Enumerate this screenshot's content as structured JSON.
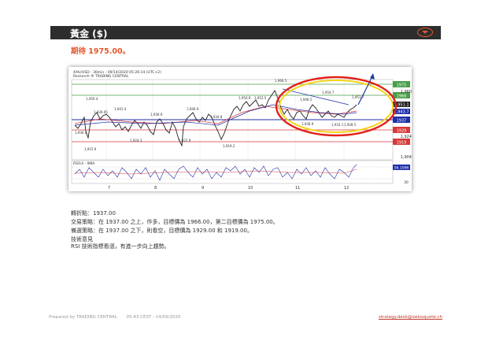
{
  "header": {
    "title": "黃金 ($)"
  },
  "subtitle": "期待 1975.00。",
  "chart": {
    "title": "XAU/USD - 30min - 09/14/2020 05:26:14 (UTC+2)",
    "source": "Research ® TRADING CENTRAL",
    "rsi_label": "RSI14 - 9MA",
    "rsi_value": "56.1096",
    "price_ticks": [
      "1,960",
      "1,951.1",
      "1,943.7",
      "1,924",
      "1,904"
    ],
    "level_labels": [
      "1975",
      "1966",
      "1937",
      "1929",
      "1919"
    ],
    "rsi_ticks": [
      "70",
      "30"
    ],
    "day_labels": [
      "7",
      "8",
      "9",
      "10",
      "11",
      "12"
    ],
    "point_labels": [
      "1,950.4",
      "1,939.05",
      "1,941.4",
      "1,936.9",
      "1,946.9",
      "1,934.8",
      "1,950.9",
      "1,953.5",
      "1,966.5",
      "1,946.5",
      "1,954.7",
      "1,951.7",
      "1,930.4",
      "1,915.9",
      "1,924.3",
      "1,922.9",
      "1,919.2",
      "1,936.9",
      "1,933.1",
      "1,928.5"
    ],
    "colors": {
      "level_green": "#4a9e4a",
      "level_blue": "#1f2fa8",
      "level_red": "#d63a3a",
      "ellipse_outer": "#e32119",
      "ellipse_inner": "#f5d41a",
      "arrow": "#1a3c9e"
    }
  },
  "info": {
    "pivot": "轉折點：1937.00",
    "strategy": "交易策略：在 1937.00 之上，作多，目標價為 1966.00，第二目標價為 1975.00。",
    "alternative": "備選策略：在 1937.00 之下，則看空，目標價為 1929.00 和 1919.00。",
    "tech_title": "技術意見",
    "tech_comment": "RSI 技術指標看漲，有進一步向上趨勢。"
  },
  "footer": {
    "prepared": "Prepared by TRADING CENTRAL",
    "time": "05:43 CEST - 14/09/2020",
    "email": "strategy.desk@swissquote.ch"
  }
}
